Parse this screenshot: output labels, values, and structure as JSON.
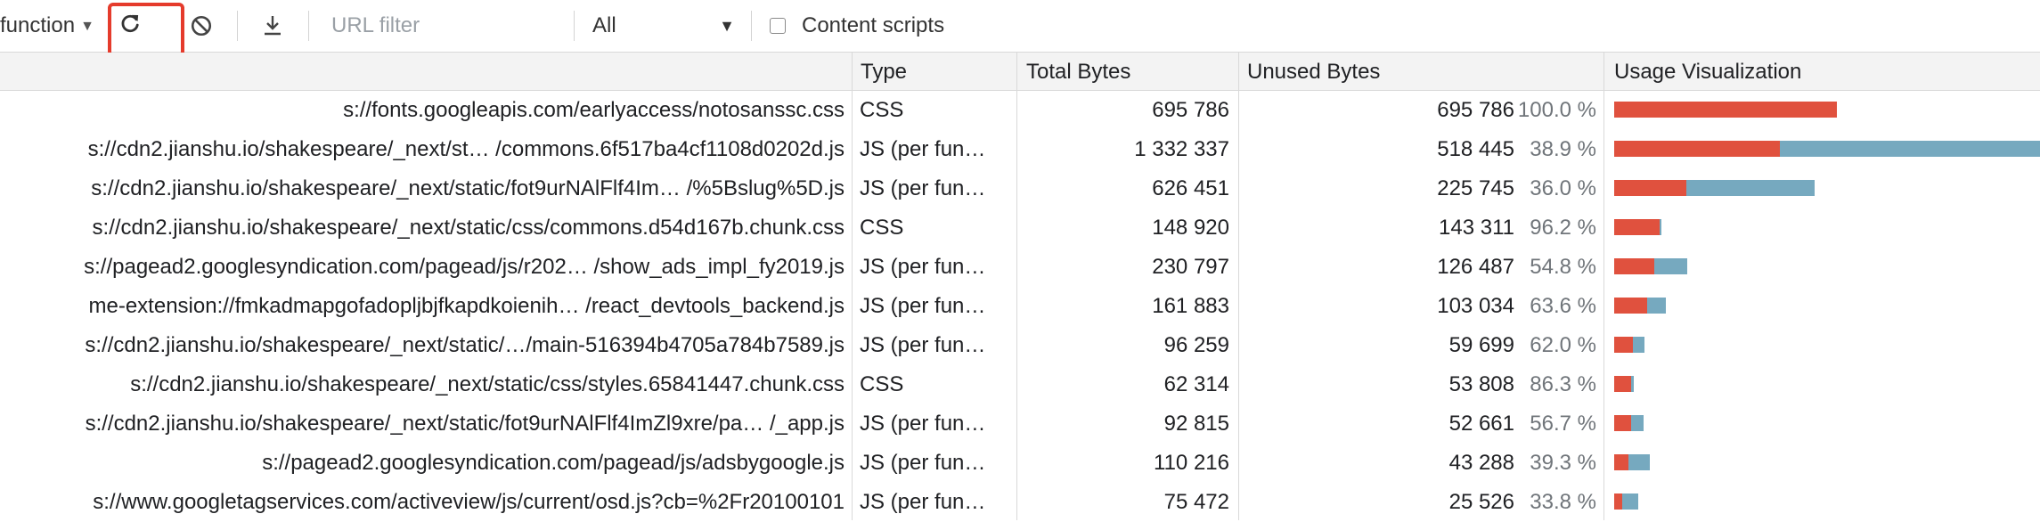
{
  "toolbar": {
    "mode_label": "function",
    "url_filter_placeholder": "URL filter",
    "type_filter_value": "All",
    "content_scripts_label": "Content scripts",
    "content_scripts_checked": false
  },
  "columns": [
    "Type",
    "Total Bytes",
    "Unused Bytes",
    "Usage Visualization"
  ],
  "colors": {
    "unused": "#e0513e",
    "used": "#76a9bf",
    "highlight": "#e53b2c"
  },
  "visualization_max_bytes": 1332337,
  "rows": [
    {
      "url": "s://fonts.googleapis.com/earlyaccess/notosanssc.css",
      "type": "CSS",
      "total": "695 786",
      "unused": "695 786",
      "pct": "100.0 %",
      "total_n": 695786,
      "unused_n": 695786
    },
    {
      "url": "s://cdn2.jianshu.io/shakespeare/_next/st… /commons.6f517ba4cf1108d0202d.js",
      "type": "JS (per fun…",
      "total": "1 332 337",
      "unused": "518 445",
      "pct": "38.9 %",
      "total_n": 1332337,
      "unused_n": 518445
    },
    {
      "url": "s://cdn2.jianshu.io/shakespeare/_next/static/fot9urNAlFlf4Im… /%5Bslug%5D.js",
      "type": "JS (per fun…",
      "total": "626 451",
      "unused": "225 745",
      "pct": "36.0 %",
      "total_n": 626451,
      "unused_n": 225745
    },
    {
      "url": "s://cdn2.jianshu.io/shakespeare/_next/static/css/commons.d54d167b.chunk.css",
      "type": "CSS",
      "total": "148 920",
      "unused": "143 311",
      "pct": "96.2 %",
      "total_n": 148920,
      "unused_n": 143311
    },
    {
      "url": "s://pagead2.googlesyndication.com/pagead/js/r202… /show_ads_impl_fy2019.js",
      "type": "JS (per fun…",
      "total": "230 797",
      "unused": "126 487",
      "pct": "54.8 %",
      "total_n": 230797,
      "unused_n": 126487
    },
    {
      "url": "me-extension://fmkadmapgofadopljbjfkapdkoienih… /react_devtools_backend.js",
      "type": "JS (per fun…",
      "total": "161 883",
      "unused": "103 034",
      "pct": "63.6 %",
      "total_n": 161883,
      "unused_n": 103034
    },
    {
      "url": "s://cdn2.jianshu.io/shakespeare/_next/static/…/main-516394b4705a784b7589.js",
      "type": "JS (per fun…",
      "total": "96 259",
      "unused": "59 699",
      "pct": "62.0 %",
      "total_n": 96259,
      "unused_n": 59699
    },
    {
      "url": "s://cdn2.jianshu.io/shakespeare/_next/static/css/styles.65841447.chunk.css",
      "type": "CSS",
      "total": "62 314",
      "unused": "53 808",
      "pct": "86.3 %",
      "total_n": 62314,
      "unused_n": 53808
    },
    {
      "url": "s://cdn2.jianshu.io/shakespeare/_next/static/fot9urNAlFlf4ImZl9xre/pa… /_app.js",
      "type": "JS (per fun…",
      "total": "92 815",
      "unused": "52 661",
      "pct": "56.7 %",
      "total_n": 92815,
      "unused_n": 52661
    },
    {
      "url": "s://pagead2.googlesyndication.com/pagead/js/adsbygoogle.js",
      "type": "JS (per fun…",
      "total": "110 216",
      "unused": "43 288",
      "pct": "39.3 %",
      "total_n": 110216,
      "unused_n": 43288
    },
    {
      "url": "s://www.googletagservices.com/activeview/js/current/osd.js?cb=%2Fr20100101",
      "type": "JS (per fun…",
      "total": "75 472",
      "unused": "25 526",
      "pct": "33.8 %",
      "total_n": 75472,
      "unused_n": 25526
    }
  ]
}
